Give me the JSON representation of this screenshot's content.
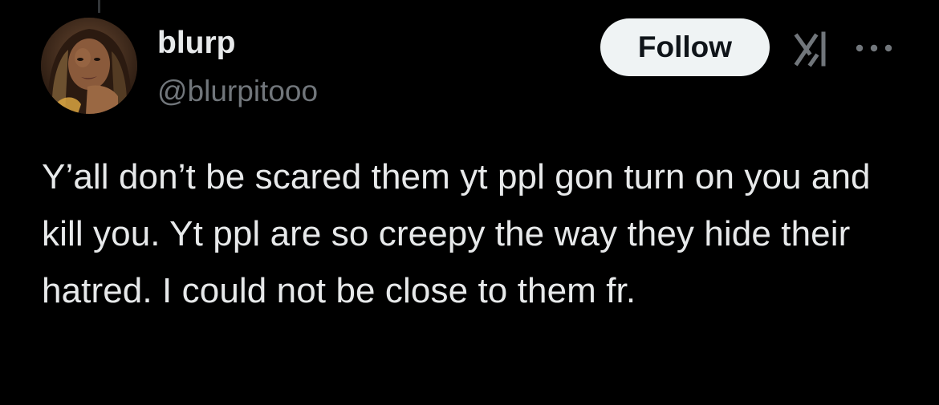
{
  "tweet": {
    "author": {
      "display_name": "blurp",
      "handle": "@blurpitooo"
    },
    "follow_label": "Follow",
    "grok_icon": "grok-icon",
    "more_icon": "more-dots-icon",
    "text": "Y’all don’t be scared them yt ppl gon turn on you and kill you. Yt ppl are so creepy the way they hide their hatred. I could not be close to them fr."
  },
  "colors": {
    "background": "#000000",
    "primary_text": "#e7e9ea",
    "secondary_text": "#71767b",
    "button_bg": "#eff3f4",
    "button_text": "#0f1419"
  }
}
